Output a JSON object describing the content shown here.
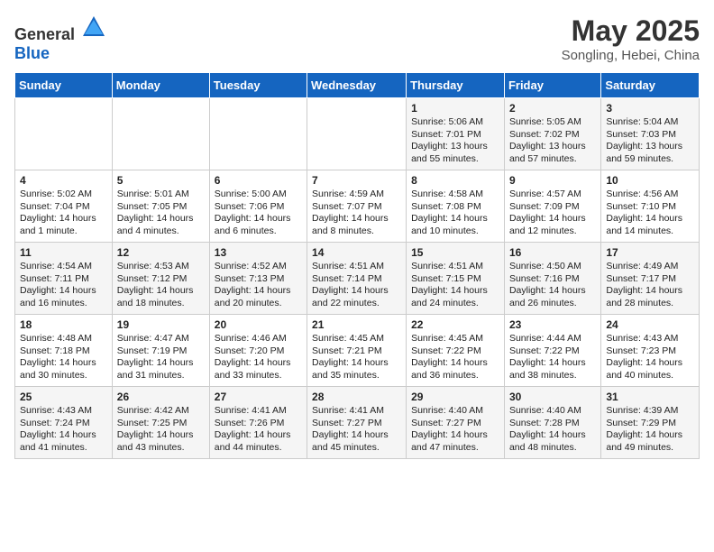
{
  "header": {
    "logo_general": "General",
    "logo_blue": "Blue",
    "month_title": "May 2025",
    "subtitle": "Songling, Hebei, China"
  },
  "weekdays": [
    "Sunday",
    "Monday",
    "Tuesday",
    "Wednesday",
    "Thursday",
    "Friday",
    "Saturday"
  ],
  "weeks": [
    [
      {
        "day": "",
        "text": ""
      },
      {
        "day": "",
        "text": ""
      },
      {
        "day": "",
        "text": ""
      },
      {
        "day": "",
        "text": ""
      },
      {
        "day": "1",
        "text": "Sunrise: 5:06 AM\nSunset: 7:01 PM\nDaylight: 13 hours\nand 55 minutes."
      },
      {
        "day": "2",
        "text": "Sunrise: 5:05 AM\nSunset: 7:02 PM\nDaylight: 13 hours\nand 57 minutes."
      },
      {
        "day": "3",
        "text": "Sunrise: 5:04 AM\nSunset: 7:03 PM\nDaylight: 13 hours\nand 59 minutes."
      }
    ],
    [
      {
        "day": "4",
        "text": "Sunrise: 5:02 AM\nSunset: 7:04 PM\nDaylight: 14 hours\nand 1 minute."
      },
      {
        "day": "5",
        "text": "Sunrise: 5:01 AM\nSunset: 7:05 PM\nDaylight: 14 hours\nand 4 minutes."
      },
      {
        "day": "6",
        "text": "Sunrise: 5:00 AM\nSunset: 7:06 PM\nDaylight: 14 hours\nand 6 minutes."
      },
      {
        "day": "7",
        "text": "Sunrise: 4:59 AM\nSunset: 7:07 PM\nDaylight: 14 hours\nand 8 minutes."
      },
      {
        "day": "8",
        "text": "Sunrise: 4:58 AM\nSunset: 7:08 PM\nDaylight: 14 hours\nand 10 minutes."
      },
      {
        "day": "9",
        "text": "Sunrise: 4:57 AM\nSunset: 7:09 PM\nDaylight: 14 hours\nand 12 minutes."
      },
      {
        "day": "10",
        "text": "Sunrise: 4:56 AM\nSunset: 7:10 PM\nDaylight: 14 hours\nand 14 minutes."
      }
    ],
    [
      {
        "day": "11",
        "text": "Sunrise: 4:54 AM\nSunset: 7:11 PM\nDaylight: 14 hours\nand 16 minutes."
      },
      {
        "day": "12",
        "text": "Sunrise: 4:53 AM\nSunset: 7:12 PM\nDaylight: 14 hours\nand 18 minutes."
      },
      {
        "day": "13",
        "text": "Sunrise: 4:52 AM\nSunset: 7:13 PM\nDaylight: 14 hours\nand 20 minutes."
      },
      {
        "day": "14",
        "text": "Sunrise: 4:51 AM\nSunset: 7:14 PM\nDaylight: 14 hours\nand 22 minutes."
      },
      {
        "day": "15",
        "text": "Sunrise: 4:51 AM\nSunset: 7:15 PM\nDaylight: 14 hours\nand 24 minutes."
      },
      {
        "day": "16",
        "text": "Sunrise: 4:50 AM\nSunset: 7:16 PM\nDaylight: 14 hours\nand 26 minutes."
      },
      {
        "day": "17",
        "text": "Sunrise: 4:49 AM\nSunset: 7:17 PM\nDaylight: 14 hours\nand 28 minutes."
      }
    ],
    [
      {
        "day": "18",
        "text": "Sunrise: 4:48 AM\nSunset: 7:18 PM\nDaylight: 14 hours\nand 30 minutes."
      },
      {
        "day": "19",
        "text": "Sunrise: 4:47 AM\nSunset: 7:19 PM\nDaylight: 14 hours\nand 31 minutes."
      },
      {
        "day": "20",
        "text": "Sunrise: 4:46 AM\nSunset: 7:20 PM\nDaylight: 14 hours\nand 33 minutes."
      },
      {
        "day": "21",
        "text": "Sunrise: 4:45 AM\nSunset: 7:21 PM\nDaylight: 14 hours\nand 35 minutes."
      },
      {
        "day": "22",
        "text": "Sunrise: 4:45 AM\nSunset: 7:22 PM\nDaylight: 14 hours\nand 36 minutes."
      },
      {
        "day": "23",
        "text": "Sunrise: 4:44 AM\nSunset: 7:22 PM\nDaylight: 14 hours\nand 38 minutes."
      },
      {
        "day": "24",
        "text": "Sunrise: 4:43 AM\nSunset: 7:23 PM\nDaylight: 14 hours\nand 40 minutes."
      }
    ],
    [
      {
        "day": "25",
        "text": "Sunrise: 4:43 AM\nSunset: 7:24 PM\nDaylight: 14 hours\nand 41 minutes."
      },
      {
        "day": "26",
        "text": "Sunrise: 4:42 AM\nSunset: 7:25 PM\nDaylight: 14 hours\nand 43 minutes."
      },
      {
        "day": "27",
        "text": "Sunrise: 4:41 AM\nSunset: 7:26 PM\nDaylight: 14 hours\nand 44 minutes."
      },
      {
        "day": "28",
        "text": "Sunrise: 4:41 AM\nSunset: 7:27 PM\nDaylight: 14 hours\nand 45 minutes."
      },
      {
        "day": "29",
        "text": "Sunrise: 4:40 AM\nSunset: 7:27 PM\nDaylight: 14 hours\nand 47 minutes."
      },
      {
        "day": "30",
        "text": "Sunrise: 4:40 AM\nSunset: 7:28 PM\nDaylight: 14 hours\nand 48 minutes."
      },
      {
        "day": "31",
        "text": "Sunrise: 4:39 AM\nSunset: 7:29 PM\nDaylight: 14 hours\nand 49 minutes."
      }
    ]
  ]
}
